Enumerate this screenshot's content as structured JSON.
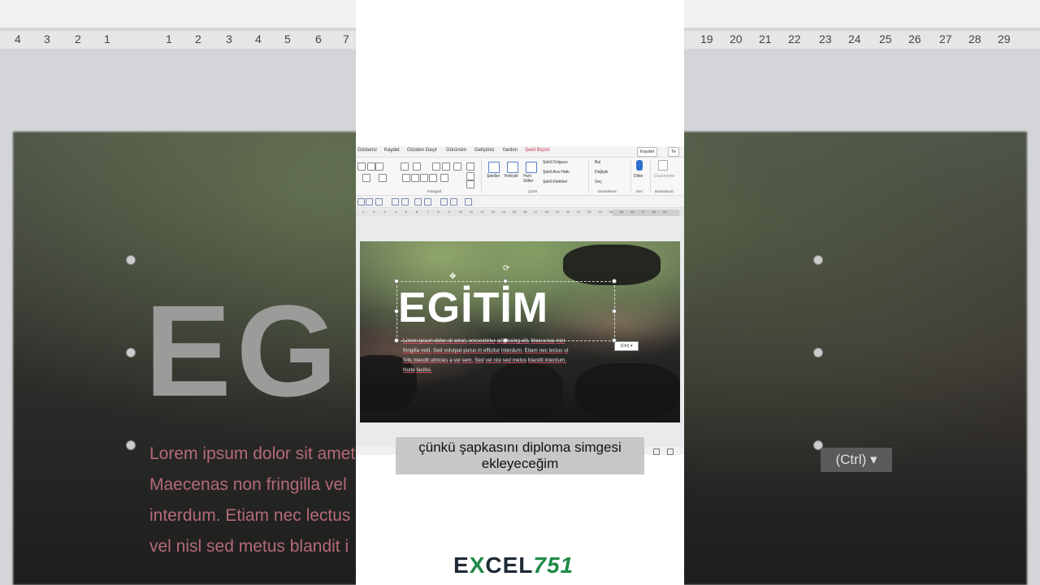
{
  "background": {
    "ruler_numbers": [
      "4",
      "3",
      "2",
      "1",
      "1",
      "1",
      "2",
      "3",
      "4",
      "5",
      "6",
      "7",
      "19",
      "20",
      "21",
      "22",
      "23",
      "24",
      "25",
      "26",
      "27",
      "28",
      "29"
    ],
    "big_title": "EG",
    "lorem_lines": [
      "Lorem ipsum dolor sit amet",
      "Maecenas non fringilla vel",
      "interdum. Etiam nec lectus",
      "vel nisl sed metus blandit i"
    ],
    "ctrl_label": "(Ctrl) ▾"
  },
  "menu": {
    "items": [
      "Gösterisi",
      "Kaydet",
      "Gözden Geçir",
      "Görünüm",
      "Geliştirici",
      "Yardım",
      "Şekil Biçimi"
    ],
    "record_label": "Kaydet",
    "te_label": "Te"
  },
  "ribbon": {
    "paragraph_label": "Paragraf",
    "drawing_label": "Çizim",
    "editing_label": "Düzenleme",
    "voice_label": "Ses",
    "designer_label": "Düzenleme",
    "shapes_label": "Şekiller",
    "arrange_label": "Yerleştir",
    "quick_styles_label": "Hızlı Stiller",
    "shape_fill": "Şekil Dolgusu",
    "shape_outline": "Şekil Ana Hattı",
    "shape_effects": "Şekil Efektleri",
    "find": "Bul",
    "replace": "Değiştir",
    "select": "Seç",
    "dictate": "Dikte",
    "designer": "Düzenleme",
    "designer_group": "Düzenleyici"
  },
  "ruler": [
    "1",
    "2",
    "3",
    "4",
    "5",
    "6",
    "7",
    "8",
    "9",
    "10",
    "11",
    "12",
    "13",
    "14",
    "15",
    "16",
    "17",
    "18",
    "19",
    "20",
    "21",
    "22",
    "23",
    "24",
    "25",
    "26",
    "27",
    "28",
    "29"
  ],
  "slide": {
    "title": "EGİTİM",
    "body_words": [
      "Lorem ipsum",
      "dolor sit amet,",
      "consectetur",
      "adipiscing elit.",
      "Maecenas",
      "non",
      "fringilla velit.",
      "Sed volutpat",
      "purus in efficitur",
      "interdum.",
      "Etiam nec lectus",
      "ut",
      "felis blandit ultricies",
      "a",
      "vel",
      "sem.",
      "Sed",
      "vel nisl",
      "sed metus",
      "blandit interdum.",
      "Nulla",
      "facilisi."
    ],
    "ctrl_label": "(Ctrl) ▾"
  },
  "subtitle": [
    "çünkü şapkasını diploma simgesi",
    "ekleyeceğim"
  ],
  "logo": {
    "left": "E",
    "x": "X",
    "mid": "CEL",
    "num": "751"
  }
}
